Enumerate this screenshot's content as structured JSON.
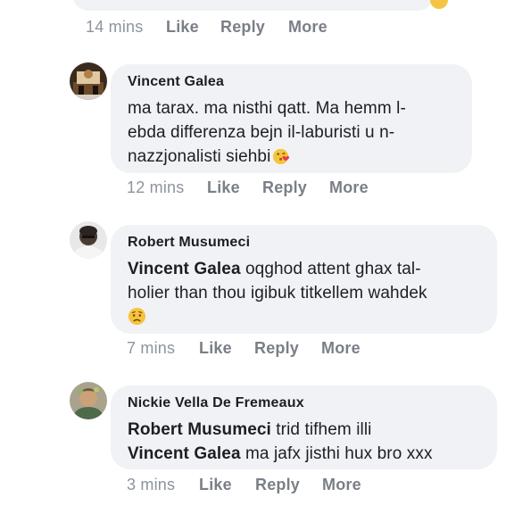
{
  "comments": [
    {
      "actions": {
        "time": "14 mins",
        "like": "Like",
        "reply": "Reply",
        "more": "More"
      }
    },
    {
      "author": "Vincent Galea",
      "lines": [
        "ma tarax. ma nisthi qatt. Ma hemm l-",
        "ebda differenza bejn il-laburisti u n-",
        "nazzjonalisti siehbi"
      ],
      "emoji_icon": "kissing-heart-emoji",
      "actions": {
        "time": "12 mins",
        "like": "Like",
        "reply": "Reply",
        "more": "More"
      }
    },
    {
      "author": "Robert Musumeci",
      "mention": "Vincent Galea",
      "lines": [
        " oqghod attent ghax tal-",
        "holier than thou igibuk titkellem wahdek"
      ],
      "emoji_icon": "worried-face-emoji",
      "actions": {
        "time": "7 mins",
        "like": "Like",
        "reply": "Reply",
        "more": "More"
      }
    },
    {
      "author": "Nickie Vella De Fremeaux",
      "line1_mention": "Robert Musumeci",
      "line1_text": " trid tifhem illi",
      "line2_mention": "Vincent Galea",
      "line2_text": " ma jafx jisthi hux bro xxx",
      "actions": {
        "time": "3 mins",
        "like": "Like",
        "reply": "Reply",
        "more": "More"
      }
    }
  ],
  "colors": {
    "bubble": "#f0f2f5",
    "meta_text": "#8d949e",
    "body_text": "#1c1e21"
  }
}
